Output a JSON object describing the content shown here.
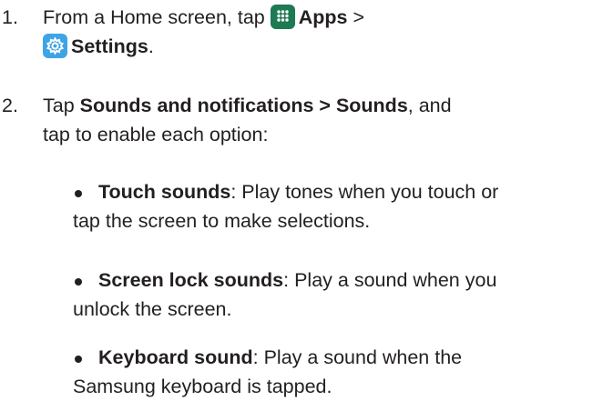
{
  "steps": [
    {
      "number": "1.",
      "prefix": "From a Home screen, tap ",
      "apps_label": "Apps",
      "separator": " >",
      "settings_label": "Settings",
      "end": "."
    },
    {
      "number": "2.",
      "prefix": "Tap ",
      "path_label": "Sounds and notifications > Sounds",
      "line1_suffix": ", and",
      "line2": "tap to enable each option:"
    }
  ],
  "options": [
    {
      "name": "Touch sounds",
      "line1": ": Play tones when you touch or",
      "line2": "tap the screen to make selections."
    },
    {
      "name": "Screen lock sounds",
      "line1": ": Play a sound when you",
      "line2": "unlock the screen."
    },
    {
      "name": "Keyboard sound",
      "line1": ": Play a sound when the",
      "line2": "Samsung keyboard is tapped."
    }
  ],
  "icons": {
    "apps": "apps-grid-icon",
    "settings": "gear-icon",
    "apps_color": "#1e7a52",
    "settings_color": "#3fa4e6"
  }
}
